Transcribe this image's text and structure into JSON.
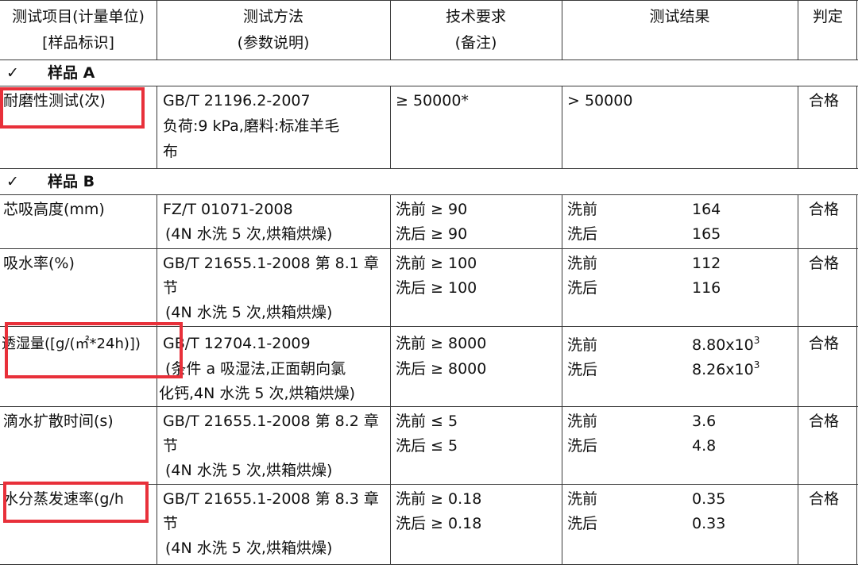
{
  "header": {
    "col1_line1": "测试项目(计量单位)",
    "col1_line2": "[样品标识]",
    "col2_line1": "测试方法",
    "col2_line2": "(参数说明)",
    "col3_line1": "技术要求",
    "col3_line2": "(备注)",
    "col4": "测试结果",
    "col5": "判定"
  },
  "samples": {
    "a": {
      "check": "✓",
      "label": "样品 A"
    },
    "b": {
      "check": "✓",
      "label": "样品 B"
    }
  },
  "rows": {
    "abrasion": {
      "item": "耐磨性测试(次)",
      "method": [
        "GB/T 21196.2-2007",
        "负荷:9 kPa,磨料:标准羊毛",
        "布"
      ],
      "requirement": "≥ 50000*",
      "result": "> 50000",
      "verdict": "合格"
    },
    "wicking": {
      "item": "芯吸高度(mm)",
      "method": [
        "FZ/T 01071-2008",
        "(4N 水洗 5 次,烘箱烘燥)"
      ],
      "req": [
        "洗前 ≥ 90",
        "洗后 ≥ 90"
      ],
      "res_labels": [
        "洗前",
        "洗后"
      ],
      "res_values": [
        "164",
        "165"
      ],
      "verdict": "合格"
    },
    "absorption": {
      "item": "吸水率(%)",
      "method": [
        "GB/T 21655.1-2008 第 8.1 章",
        "节",
        "(4N 水洗 5 次,烘箱烘燥)"
      ],
      "req": [
        "洗前 ≥ 100",
        "洗后 ≥ 100"
      ],
      "res_labels": [
        "洗前",
        "洗后"
      ],
      "res_values": [
        "112",
        "116"
      ],
      "verdict": "合格"
    },
    "moisture": {
      "item": "透湿量([g/(㎡*24h)])",
      "method": [
        "GB/T 12704.1-2009",
        "(条件 a 吸湿法,正面朝向氯",
        "化钙,4N 水洗 5 次,烘箱烘燥)"
      ],
      "req": [
        "洗前 ≥ 8000",
        "洗后 ≥ 8000"
      ],
      "res_labels": [
        "洗前",
        "洗后"
      ],
      "res_values": [
        "8.80x10",
        "8.26x10"
      ],
      "res_exp": "3",
      "verdict": "合格"
    },
    "spread": {
      "item": "滴水扩散时间(s)",
      "method": [
        "GB/T 21655.1-2008 第 8.2 章",
        "节",
        "(4N 水洗 5 次,烘箱烘燥)"
      ],
      "req": [
        "洗前 ≤ 5",
        "洗后 ≤ 5"
      ],
      "res_labels": [
        "洗前",
        "洗后"
      ],
      "res_values": [
        "3.6",
        "4.8"
      ],
      "verdict": "合格"
    },
    "evaporation": {
      "item": "水分蒸发速率(g/h",
      "method": [
        "GB/T 21655.1-2008 第 8.3 章",
        "节",
        "(4N 水洗 5 次,烘箱烘燥)"
      ],
      "req": [
        "洗前 ≥ 0.18",
        "洗后 ≥ 0.18"
      ],
      "res_labels": [
        "洗前",
        "洗后"
      ],
      "res_values": [
        "0.35",
        "0.33"
      ],
      "verdict": "合格"
    }
  },
  "colors": {
    "highlight_box": "#e8303a",
    "grid_line": "#3a3a3a",
    "text": "#111111"
  }
}
